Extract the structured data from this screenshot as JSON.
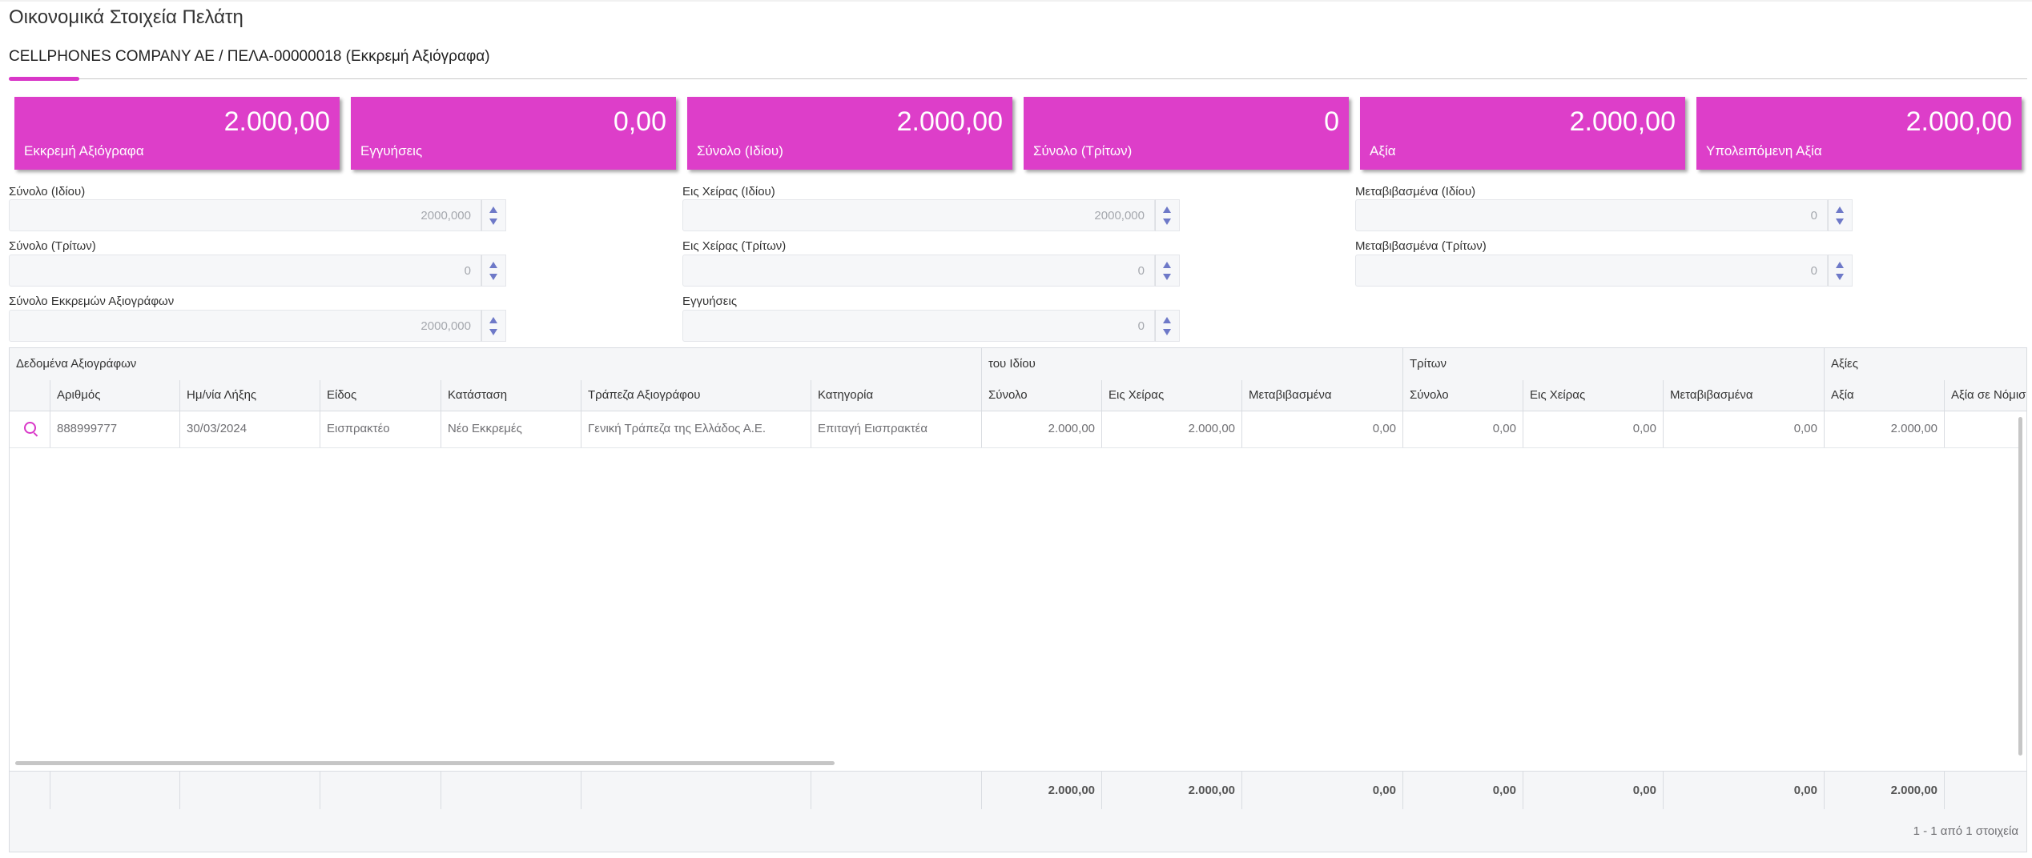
{
  "page": {
    "title": "Οικονομικά Στοιχεία Πελάτη",
    "subtitle": "CELLPHONES COMPANY AE / ΠΕΛΑ-00000018 (Εκκρεμή Αξιόγραφα)"
  },
  "cards": [
    {
      "value": "2.000,00",
      "label": "Εκκρεμή Αξιόγραφα"
    },
    {
      "value": "0,00",
      "label": "Εγγυήσεις"
    },
    {
      "value": "2.000,00",
      "label": "Σύνολο (Ιδίου)"
    },
    {
      "value": "0",
      "label": "Σύνολο (Τρίτων)"
    },
    {
      "value": "2.000,00",
      "label": "Αξία"
    },
    {
      "value": "2.000,00",
      "label": "Υπολειπόμενη Αξία"
    }
  ],
  "fields": [
    {
      "label": "Σύνολο (Ιδίου)",
      "value": "2000,000"
    },
    {
      "label": "Εις Χείρας (Ιδίου)",
      "value": "2000,000"
    },
    {
      "label": "Μεταβιβασμένα (Ιδίου)",
      "value": "0"
    },
    {
      "label": "Σύνολο (Τρίτων)",
      "value": "0"
    },
    {
      "label": "Εις Χείρας (Τρίτων)",
      "value": "0"
    },
    {
      "label": "Μεταβιβασμένα (Τρίτων)",
      "value": "0"
    },
    {
      "label": "Σύνολο Εκκρεμών Αξιογράφων",
      "value": "2000,000"
    },
    {
      "label": "Εγγυήσεις",
      "value": "0"
    }
  ],
  "grid": {
    "groups": [
      "Δεδομένα Αξιογράφων",
      "του Ιδίου",
      "Τρίτων",
      "Αξίες"
    ],
    "columns": [
      "Αριθμός",
      "Ημ/νία Λήξης",
      "Είδος",
      "Κατάσταση",
      "Τράπεζα Αξιογράφου",
      "Κατηγορία",
      "Σύνολο",
      "Εις Χείρας",
      "Μεταβιβασμένα",
      "Σύνολο",
      "Εις Χείρας",
      "Μεταβιβασμένα",
      "Αξία",
      "Αξία σε Νόμισμα"
    ],
    "rows": [
      [
        "888999777",
        "30/03/2024",
        "Εισπρακτέο",
        "Νέο Εκκρεμές",
        "Γενική Τράπεζα της Ελλάδος Α.Ε.",
        "Επιταγή Εισπρακτέα",
        "2.000,00",
        "2.000,00",
        "0,00",
        "0,00",
        "0,00",
        "0,00",
        "2.000,00",
        ""
      ]
    ],
    "totals": [
      "2.000,00",
      "2.000,00",
      "0,00",
      "0,00",
      "0,00",
      "0,00",
      "2.000,00"
    ],
    "pager": "1 - 1 από 1 στοιχεία"
  },
  "colors": {
    "accent": "#dd3ec9",
    "spinner": "#6e79c8"
  }
}
